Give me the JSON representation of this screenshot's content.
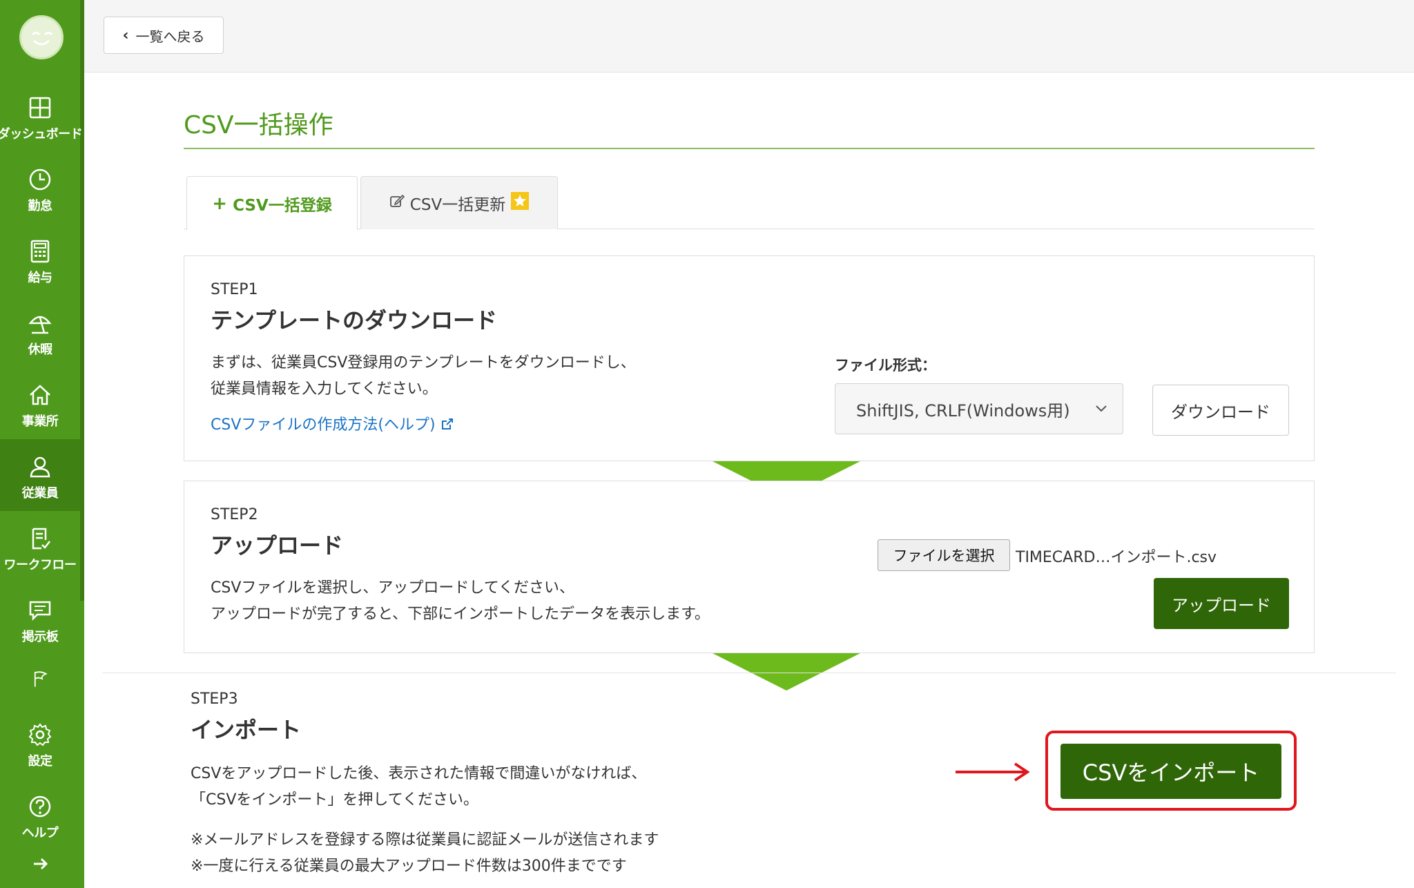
{
  "nav": {
    "items": [
      {
        "label": "ダッシュボード",
        "icon": "grid-icon"
      },
      {
        "label": "勤怠",
        "icon": "clock-icon"
      },
      {
        "label": "給与",
        "icon": "calculator-icon"
      },
      {
        "label": "休暇",
        "icon": "parasol-icon"
      },
      {
        "label": "事業所",
        "icon": "home-icon"
      },
      {
        "label": "従業員",
        "icon": "user-icon"
      },
      {
        "label": "ワークフロー",
        "icon": "checklist-icon"
      },
      {
        "label": "掲示板",
        "icon": "chat-icon"
      },
      {
        "label": "",
        "icon": "flag-icon"
      },
      {
        "label": "設定",
        "icon": "gear-icon"
      },
      {
        "label": "ヘルプ",
        "icon": "help-icon"
      }
    ],
    "active": "従業員"
  },
  "topbar": {
    "back_label": "一覧へ戻る"
  },
  "page": {
    "title": "CSV一括操作"
  },
  "tabs": [
    {
      "label": "CSV一括登録"
    },
    {
      "label": "CSV一括更新"
    }
  ],
  "step1": {
    "label": "STEP1",
    "title": "テンプレートのダウンロード",
    "desc_line1": "まずは、従業員CSV登録用のテンプレートをダウンロードし、",
    "desc_line2": "従業員情報を入力してください。",
    "help_link": "CSVファイルの作成方法(ヘルプ)",
    "format_label": "ファイル形式：",
    "format_value": "ShiftJIS, CRLF(Windows用)",
    "download_button": "ダウンロード"
  },
  "step2": {
    "label": "STEP2",
    "title": "アップロード",
    "desc_line1": "CSVファイルを選択し、アップロードしてください、",
    "desc_line2": "アップロードが完了すると、下部にインポートしたデータを表示します。",
    "file_button": "ファイルを選択",
    "file_name": "TIMECARD…インポート.csv",
    "upload_button": "アップロード"
  },
  "step3": {
    "label": "STEP3",
    "title": "インポート",
    "desc_line1": "CSVをアップロードした後、表示された情報で間違いがなければ、",
    "desc_line2": "「CSVをインポート」を押してください。",
    "note1": "※メールアドレスを登録する際は従業員に認証メールが送信されます",
    "note2": "※一度に行える従業員の最大アップロード件数は300件までです",
    "import_button": "CSVをインポート"
  },
  "colors": {
    "sidebar": "#4f9a1c",
    "accent": "#4f9a1c",
    "primary_button": "#2f6607",
    "annotation": "#e0161c",
    "link": "#1a73c6"
  }
}
